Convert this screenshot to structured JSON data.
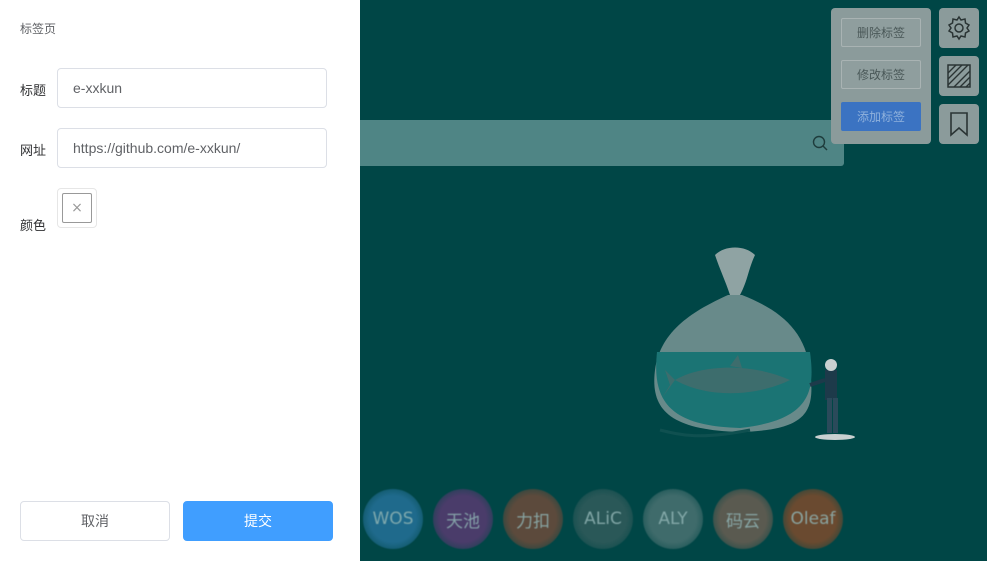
{
  "drawer": {
    "title": "标签页",
    "fields": {
      "title_label": "标题",
      "title_value": "e-xxkun",
      "url_label": "网址",
      "url_value": "https://github.com/e-xxkun/",
      "color_label": "颜色",
      "color_empty_icon": "×"
    },
    "buttons": {
      "cancel": "取消",
      "submit": "提交"
    }
  },
  "background": {
    "panel": {
      "delete_tag": "删除标签",
      "edit_tag": "修改标签",
      "add_tag": "添加标签"
    },
    "icons": [
      "settings-icon",
      "wallpaper-icon",
      "bookmark-icon",
      "search-icon"
    ],
    "bubbles": [
      {
        "label": "WOS",
        "color": "#1f6a8c"
      },
      {
        "label": "天池",
        "color": "#4a3c6a"
      },
      {
        "label": "力扣",
        "color": "#5c4a3c"
      },
      {
        "label": "ALiC",
        "color": "#2a5858"
      },
      {
        "label": "ALY",
        "color": "#3f6b6b"
      },
      {
        "label": "码云",
        "color": "#5a5a50"
      },
      {
        "label": "Oleaf",
        "color": "#6a4a30"
      }
    ]
  },
  "colors": {
    "accent": "#409eff",
    "background": "#004646"
  }
}
